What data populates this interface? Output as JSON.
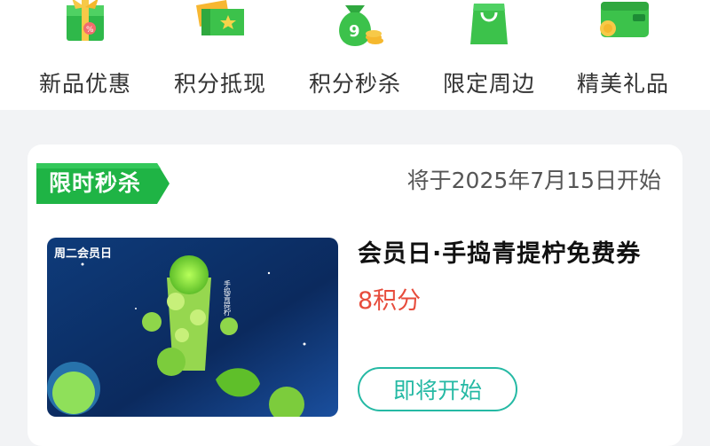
{
  "categories": [
    {
      "label": "新品优惠",
      "icon": "gift-box-icon"
    },
    {
      "label": "积分抵现",
      "icon": "ticket-icon"
    },
    {
      "label": "积分秒杀",
      "icon": "money-bag-icon",
      "badge": "9"
    },
    {
      "label": "限定周边",
      "icon": "shopping-bag-icon"
    },
    {
      "label": "精美礼品",
      "icon": "wallet-icon"
    }
  ],
  "flash_sale": {
    "tag": "限时秒杀",
    "start_time": "将于2025年7月15日开始",
    "product": {
      "image_label": "周二会员日",
      "image_side_text": "手捣青提柠",
      "title": "会员日·手捣青提柠免费券",
      "points": "8积分",
      "button": "即将开始"
    }
  },
  "colors": {
    "accent_green": "#3cc24b",
    "tag_green": "#1fb445",
    "tag_text_yellow": "#ffffff",
    "points_red": "#e74c3c",
    "button_teal": "#25b9a4"
  }
}
